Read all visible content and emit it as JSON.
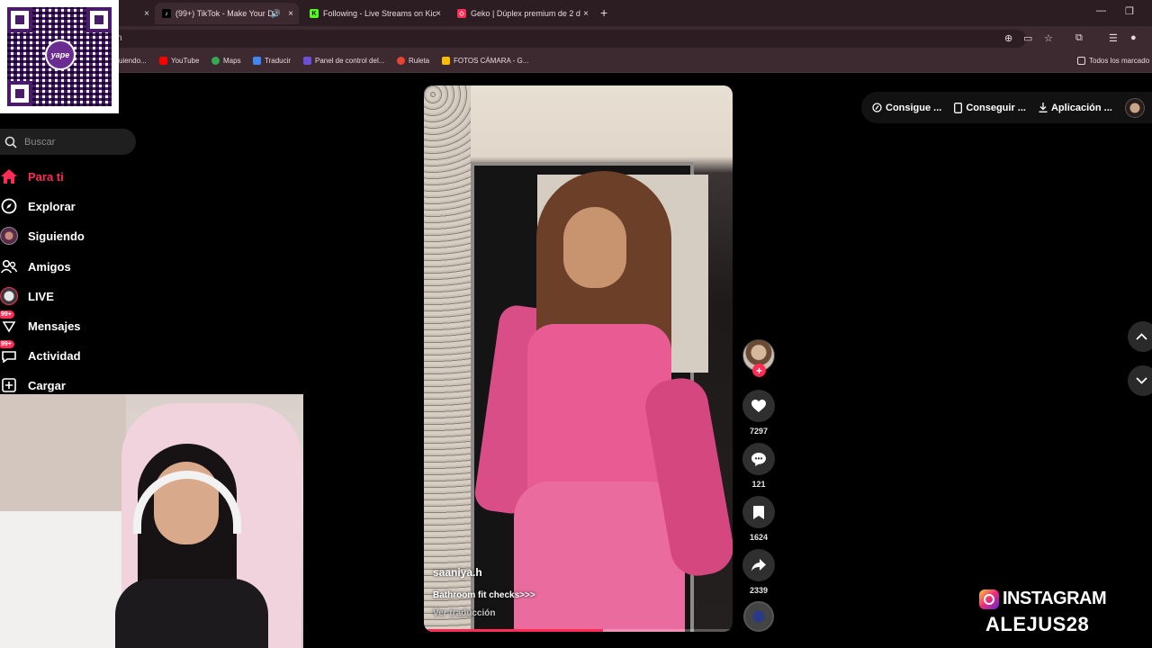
{
  "browser": {
    "tabs": [
      {
        "title": "(99+) TikTok - Make Your Da",
        "active": true
      },
      {
        "title": "Following - Live Streams on Kic",
        "active": false
      },
      {
        "title": "Geko | Dúplex premium de 2 d",
        "active": false
      }
    ],
    "close_glyph": "×",
    "newtab_glyph": "+",
    "address_text": "n",
    "bookmarks": [
      {
        "label": "uiendo...",
        "color": "#7a6a70"
      },
      {
        "label": "YouTube",
        "color": "#ff0000"
      },
      {
        "label": "Maps",
        "color": "#34a853"
      },
      {
        "label": "Traducir",
        "color": "#4285f4"
      },
      {
        "label": "Panel de control del...",
        "color": "#6c4fd8"
      },
      {
        "label": "Ruleta",
        "color": "#ea4335"
      },
      {
        "label": "FOTOS CÁMARA - G...",
        "color": "#fbbc04"
      }
    ],
    "all_bookmarks": "Todos los marcado"
  },
  "qr": {
    "logo_text": "yape"
  },
  "sidebar": {
    "search_placeholder": "Buscar",
    "items": [
      {
        "label": "Para ti",
        "icon": "home-icon",
        "active": true,
        "badge": ""
      },
      {
        "label": "Explorar",
        "icon": "compass-icon",
        "active": false,
        "badge": ""
      },
      {
        "label": "Siguiendo",
        "icon": "avatar-icon",
        "active": false,
        "badge": ""
      },
      {
        "label": "Amigos",
        "icon": "friends-icon",
        "active": false,
        "badge": ""
      },
      {
        "label": "LIVE",
        "icon": "live-icon",
        "active": false,
        "badge": ""
      },
      {
        "label": "Mensajes",
        "icon": "message-icon",
        "active": false,
        "badge": "99+"
      },
      {
        "label": "Actividad",
        "icon": "activity-icon",
        "active": false,
        "badge": "99+"
      },
      {
        "label": "Cargar",
        "icon": "upload-icon",
        "active": false,
        "badge": ""
      }
    ]
  },
  "video": {
    "author": "saaniya.h",
    "description": "Bathroom fit checks>>>",
    "translate": "Ver traducción",
    "progress": 0.58
  },
  "actions": {
    "likes": "7297",
    "comments": "121",
    "saves": "1624",
    "shares": "2339"
  },
  "top_actions": {
    "coins": "Consigue ...",
    "app": "Conseguir ...",
    "download": "Aplicación ..."
  },
  "overlay": {
    "instagram_label": "INSTAGRAM",
    "instagram_handle": "ALEJUS28"
  }
}
